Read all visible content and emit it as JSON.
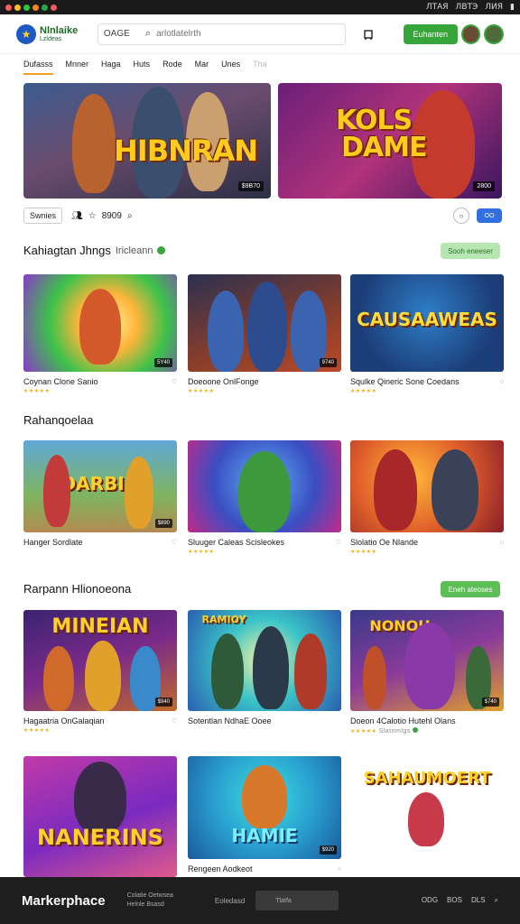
{
  "status": {
    "right1": "ЛТАЯ",
    "right2": "ЛВТЭ",
    "right3": "ЛИЯ"
  },
  "header": {
    "logo_line1": "Nlnlaike",
    "logo_line2": "Lzldeas",
    "search_scope": "OAGE",
    "search_placeholder": "arlotlatelrth",
    "cta_label": "Euhanten"
  },
  "nav": [
    "Dufasss",
    "Mnner",
    "Haga",
    "Huts",
    "Rode",
    "Mar",
    "Unes",
    "Tha"
  ],
  "banners": [
    {
      "title": "HIBNRAN",
      "price": "$9B70"
    },
    {
      "title_line1": "KOLS",
      "title_line2": "DAME",
      "price": "2800"
    }
  ],
  "filters": {
    "chip": "Swnies",
    "people_label": "",
    "tag_label": "8909",
    "toggle_label": "OO"
  },
  "sections": [
    {
      "title": "Kahiagtan Jhngs",
      "subtitle": "Iricleann",
      "see_all": "Sooh eneeser",
      "cards": [
        {
          "name": "Coynan Clone Sanio",
          "price": "5Y40",
          "rating": 4
        },
        {
          "name": "Doeoone OnlFonge",
          "price": "9740",
          "rating": 4
        },
        {
          "name": "Squlke Qineric Sone Coedans",
          "price": "",
          "thumb_title": "CAUSAAWEAS",
          "rating": 4
        }
      ]
    },
    {
      "title": "Rahanqoelaa",
      "cards": [
        {
          "name": "Hanger Sordlate",
          "price": "$890",
          "thumb_title": "DARBIN",
          "rating": 4
        },
        {
          "name": "Sluuger Caleas Scisleokes",
          "price": "",
          "rating": 4
        },
        {
          "name": "Slolatio Oe Nlande",
          "price": "",
          "rating": 4
        }
      ]
    },
    {
      "title": "Rarpann Hlionoeona",
      "see_all": "Eneh ateoses",
      "cards": [
        {
          "name": "Hagaatria OnGalaqian",
          "price": "$940",
          "thumb_title": "MINEIAN",
          "rating": 4
        },
        {
          "name": "Sotentlan NdhaE Ooee",
          "price": "$20",
          "thumb_title": "RAMIOY",
          "rating": 4
        },
        {
          "name": "Doeon 4Calotio Hutehl Olans",
          "sub": "Slatnmlgs",
          "price": "$740",
          "thumb_title": "NONOH",
          "rating": 4
        },
        {
          "name": "",
          "price": "",
          "thumb_title": "NANERINS",
          "rating": 0
        },
        {
          "name": "Rengeen Aodkeot",
          "price": "$920",
          "thumb_title": "HAMIE",
          "rating": 0
        },
        {
          "name": "",
          "price": "",
          "thumb_title": "SAHAUMOERT",
          "rating": 0
        }
      ]
    }
  ],
  "footer": {
    "brand": "Markerphace",
    "link1": "Colatie Oetwsea",
    "link2": "Helnle Bsasd",
    "label": "Eoledasd",
    "search_placeholder": "Tlatfa",
    "icons": [
      "ODG",
      "BOS",
      "DLS"
    ]
  },
  "colors": {
    "accent": "#36a63a",
    "blue": "#2f6fe0",
    "star": "#f2b010"
  }
}
